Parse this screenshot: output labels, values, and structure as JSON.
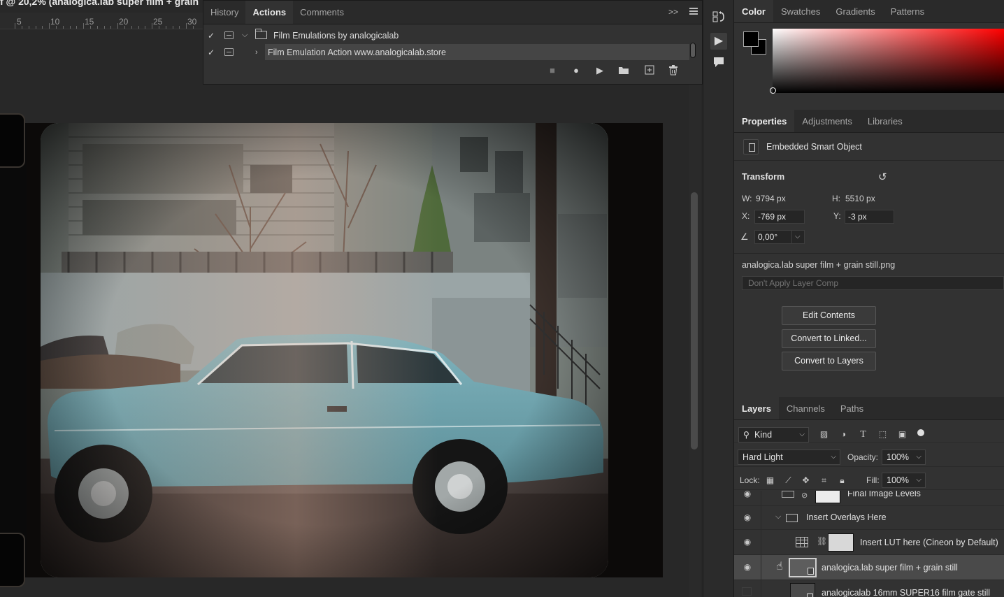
{
  "document": {
    "title": "f @ 20,2% (analogica.lab super film + grain",
    "ruler_ticks": [
      "5",
      "10",
      "15",
      "20",
      "25",
      "30"
    ]
  },
  "actions_panel": {
    "tabs": [
      "History",
      "Actions",
      "Comments"
    ],
    "active_tab": "Actions",
    "rows": [
      {
        "label": "Film Emulations by analogicalab",
        "type": "set",
        "expanded": true
      },
      {
        "label": "Film Emulation Action www.analogicalab.store",
        "type": "action",
        "expanded": false,
        "selected": true
      }
    ],
    "toolbar": {
      "stop": "■",
      "record": "●",
      "play": "▶",
      "new_set": "folder",
      "new_action": "⊞",
      "delete": "trash"
    },
    "expand_glyph": ">>"
  },
  "color_panel": {
    "tabs": [
      "Color",
      "Swatches",
      "Gradients",
      "Patterns"
    ],
    "active_tab": "Color",
    "foreground": "#000000",
    "background": "#000000",
    "hue": "#ff0000"
  },
  "properties_panel": {
    "tabs": [
      "Properties",
      "Adjustments",
      "Libraries"
    ],
    "active_tab": "Properties",
    "object_type": "Embedded Smart Object",
    "transform_heading": "Transform",
    "w_label": "W:",
    "w_value": "9794 px",
    "h_label": "H:",
    "h_value": "5510 px",
    "x_label": "X:",
    "x_value": "-769 px",
    "y_label": "Y:",
    "y_value": "-3 px",
    "angle_value": "0,00°",
    "filename": "analogica.lab super film + grain still.png",
    "layer_comp_placeholder": "Don't Apply Layer Comp",
    "buttons": {
      "edit": "Edit Contents",
      "convert_linked": "Convert to Linked...",
      "convert_layers": "Convert to Layers"
    }
  },
  "layers_panel": {
    "tabs": [
      "Layers",
      "Channels",
      "Paths"
    ],
    "active_tab": "Layers",
    "filter_kind": "Kind",
    "blend_mode": "Hard Light",
    "opacity_label": "Opacity:",
    "opacity_value": "100%",
    "lock_label": "Lock:",
    "fill_label": "Fill:",
    "fill_value": "100%",
    "layers": [
      {
        "name": "Final Image Levels",
        "visible": true,
        "kind": "adjustment"
      },
      {
        "name": "Insert Overlays Here",
        "visible": true,
        "kind": "group",
        "expanded": true
      },
      {
        "name": "Insert LUT here (Cineon by Default)",
        "visible": true,
        "kind": "lut"
      },
      {
        "name": "analogica.lab super film + grain still",
        "visible": true,
        "kind": "smart-object",
        "selected": true
      },
      {
        "name": "analogicalab 16mm SUPER16 film gate still",
        "visible": false,
        "kind": "smart-object"
      }
    ]
  }
}
